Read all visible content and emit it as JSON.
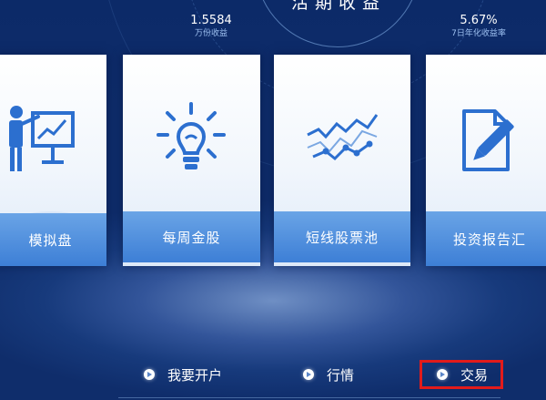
{
  "header": {
    "title": "活期收益"
  },
  "stats": {
    "left": {
      "value": "1.5584",
      "label": "万份收益"
    },
    "right": {
      "value": "5.67%",
      "label": "7日年化收益率"
    }
  },
  "cards": [
    {
      "label": "模拟盘",
      "icon": "presentation-chart-icon"
    },
    {
      "label": "每周金股",
      "icon": "lightbulb-icon"
    },
    {
      "label": "短线股票池",
      "icon": "line-chart-icon"
    },
    {
      "label": "投资报告汇",
      "icon": "document-pen-icon"
    }
  ],
  "nav": {
    "open_account": "我要开户",
    "quotes": "行情",
    "trade": "交易"
  },
  "colors": {
    "background": "#173a7c",
    "card_label": "#4d8fdc",
    "icon_blue": "#2c6fcf",
    "highlight": "#e21b1b"
  }
}
